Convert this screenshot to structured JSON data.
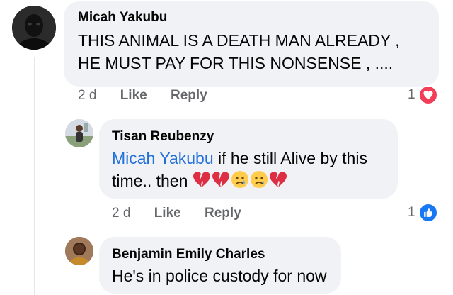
{
  "comments": [
    {
      "author": "Micah Yakubu",
      "lines": [
        "THIS ANIMAL IS A DEATH MAN ALREADY ,",
        "HE MUST PAY FOR THIS NONSENSE , ...."
      ],
      "time": "2 d",
      "like_label": "Like",
      "reply_label": "Reply",
      "reaction_count": "1",
      "reaction_type": "love-icon",
      "reaction_color": "#f33e58"
    },
    {
      "author": "Tisan Reubenzy",
      "mention": "Micah Yakubu",
      "line1_rest": " if he still Alive by this",
      "line2": "time.. then",
      "emojis": [
        "broken-heart-icon",
        "broken-heart-icon",
        "crying-face-icon",
        "crying-face-icon",
        "broken-heart-icon"
      ],
      "time": "2 d",
      "like_label": "Like",
      "reply_label": "Reply",
      "reaction_count": "1",
      "reaction_type": "like-icon",
      "reaction_color": "#1877f2"
    },
    {
      "author": "Benjamin Emily Charles",
      "lines": [
        "He's in police custody for now"
      ]
    }
  ]
}
